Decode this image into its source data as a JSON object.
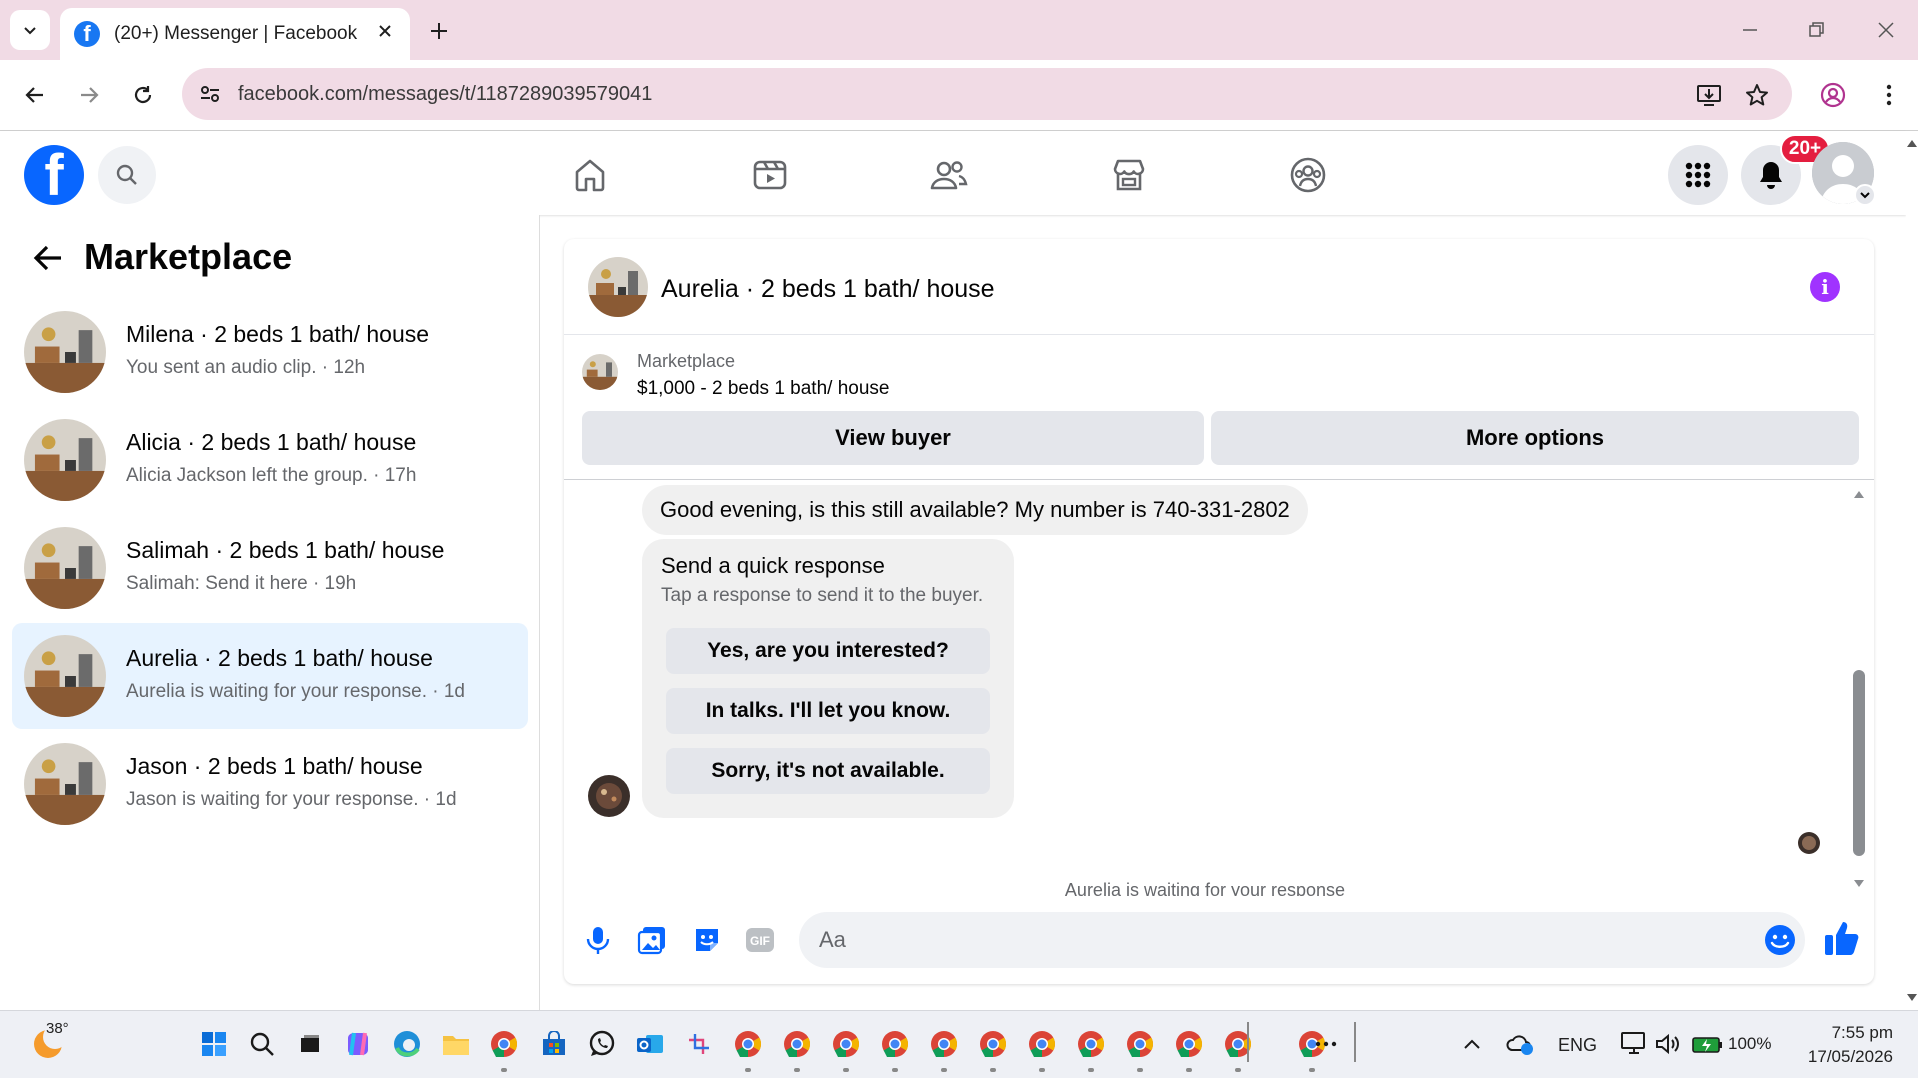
{
  "browser": {
    "tab_title": "(20+) Messenger | Facebook",
    "url": "facebook.com/messages/t/1187289039579041"
  },
  "header": {
    "notification_badge": "20+",
    "nav_icons": [
      "home-icon",
      "video-icon",
      "friends-icon",
      "marketplace-icon",
      "groups-icon"
    ]
  },
  "left_panel": {
    "title": "Marketplace",
    "conversations": [
      {
        "name": "Milena · 2 beds 1 bath/ house",
        "preview": "You sent an audio clip. · 12h",
        "active": false
      },
      {
        "name": "Alicia · 2 beds 1 bath/ house",
        "preview": "Alicia Jackson left the group. · 17h",
        "active": false
      },
      {
        "name": "Salimah · 2 beds 1 bath/ house",
        "preview": "Salimah: Send it here · 19h",
        "active": false
      },
      {
        "name": "Aurelia · 2 beds 1 bath/ house",
        "preview": "Aurelia is waiting for your response. · 1d",
        "active": true
      },
      {
        "name": "Jason · 2 beds 1 bath/ house",
        "preview": "Jason is waiting for your response. · 1d",
        "active": false
      }
    ]
  },
  "chat": {
    "title": "Aurelia · 2 beds 1 bath/ house",
    "listing_label": "Marketplace",
    "listing_price": "$1,000 - 2 beds 1 bath/ house",
    "view_buyer": "View buyer",
    "more_options": "More options",
    "message": "Good evening, is this still available? My number is 740-331-2802",
    "quick_title": "Send a quick response",
    "quick_subtitle": "Tap a response to send it to the buyer.",
    "quick_responses": [
      "Yes, are you interested?",
      "In talks. I'll let you know.",
      "Sorry, it's not available."
    ],
    "waiting": "Aurelia is waiting for your response",
    "input_placeholder": "Aa"
  },
  "taskbar": {
    "temperature": "38°",
    "language": "ENG",
    "battery": "100%",
    "time": "7:55 pm",
    "date": "17/05/2026"
  },
  "colors": {
    "facebook_blue": "#0866ff",
    "active_conversation": "#e7f3ff",
    "notification_red": "#e41e3f",
    "info_purple": "#a033ff",
    "browser_tab_strip": "#f1dbe5"
  }
}
